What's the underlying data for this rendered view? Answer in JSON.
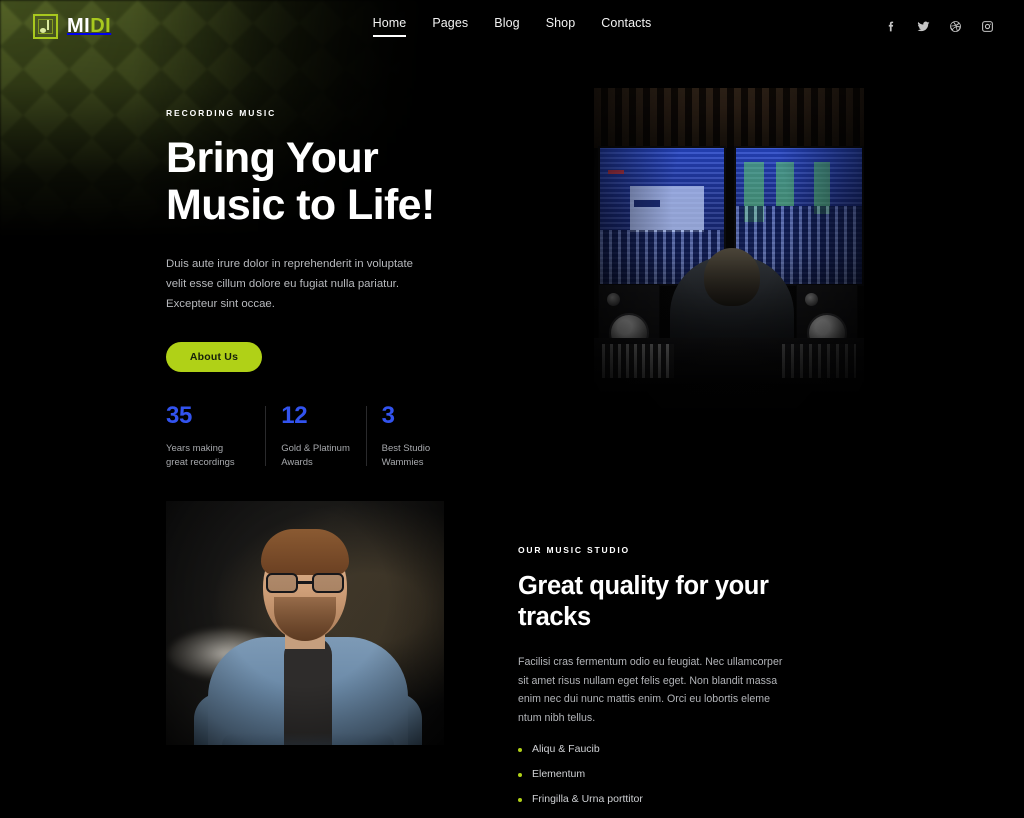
{
  "theme": {
    "background": "#000000",
    "accent_green": "#b0d117",
    "accent_blue": "#3253ef",
    "text_muted": "#b2b4b8"
  },
  "header": {
    "logo": {
      "icon": "music-note-square-icon",
      "text_light": "MI",
      "text_accent": "DI"
    },
    "nav": [
      {
        "label": "Home",
        "active": true
      },
      {
        "label": "Pages",
        "active": false
      },
      {
        "label": "Blog",
        "active": false
      },
      {
        "label": "Shop",
        "active": false
      },
      {
        "label": "Contacts",
        "active": false
      }
    ],
    "socials": [
      {
        "name": "facebook-icon"
      },
      {
        "name": "twitter-icon"
      },
      {
        "name": "dribbble-icon"
      },
      {
        "name": "instagram-icon"
      }
    ]
  },
  "hero": {
    "eyebrow": "RECORDING MUSIC",
    "title_line1": "Bring Your",
    "title_line2": "Music to Life!",
    "paragraph": "Duis aute irure dolor in reprehenderit in voluptate velit esse cillum dolore eu fugiat nulla pariatur. Excepteur sint occae.",
    "button_label": "About Us",
    "stats": [
      {
        "value": "35",
        "label_line1": "Years making",
        "label_line2": "great recordings"
      },
      {
        "value": "12",
        "label_line1": "Gold & Platinum",
        "label_line2": "Awards"
      },
      {
        "value": "3",
        "label_line1": "Best Studio",
        "label_line2": "Wammies"
      }
    ],
    "image_alt": "Audio engineer at mixing console with dual DAW monitors in studio"
  },
  "about": {
    "eyebrow": "OUR MUSIC STUDIO",
    "title_line1": "Great quality for your",
    "title_line2": "tracks",
    "paragraph": "Facilisi cras fermentum odio eu feugiat. Nec ullamcorper sit amet risus nullam eget felis eget. Non blandit massa enim nec dui nunc mattis enim. Orci eu lobortis eleme ntum nibh tellus.",
    "list": [
      "Aliqu & Faucib",
      "Elementum",
      "Fringilla & Urna porttitor"
    ],
    "image_alt": "Portrait of bearded man with glasses in denim shirt, arms crossed"
  }
}
